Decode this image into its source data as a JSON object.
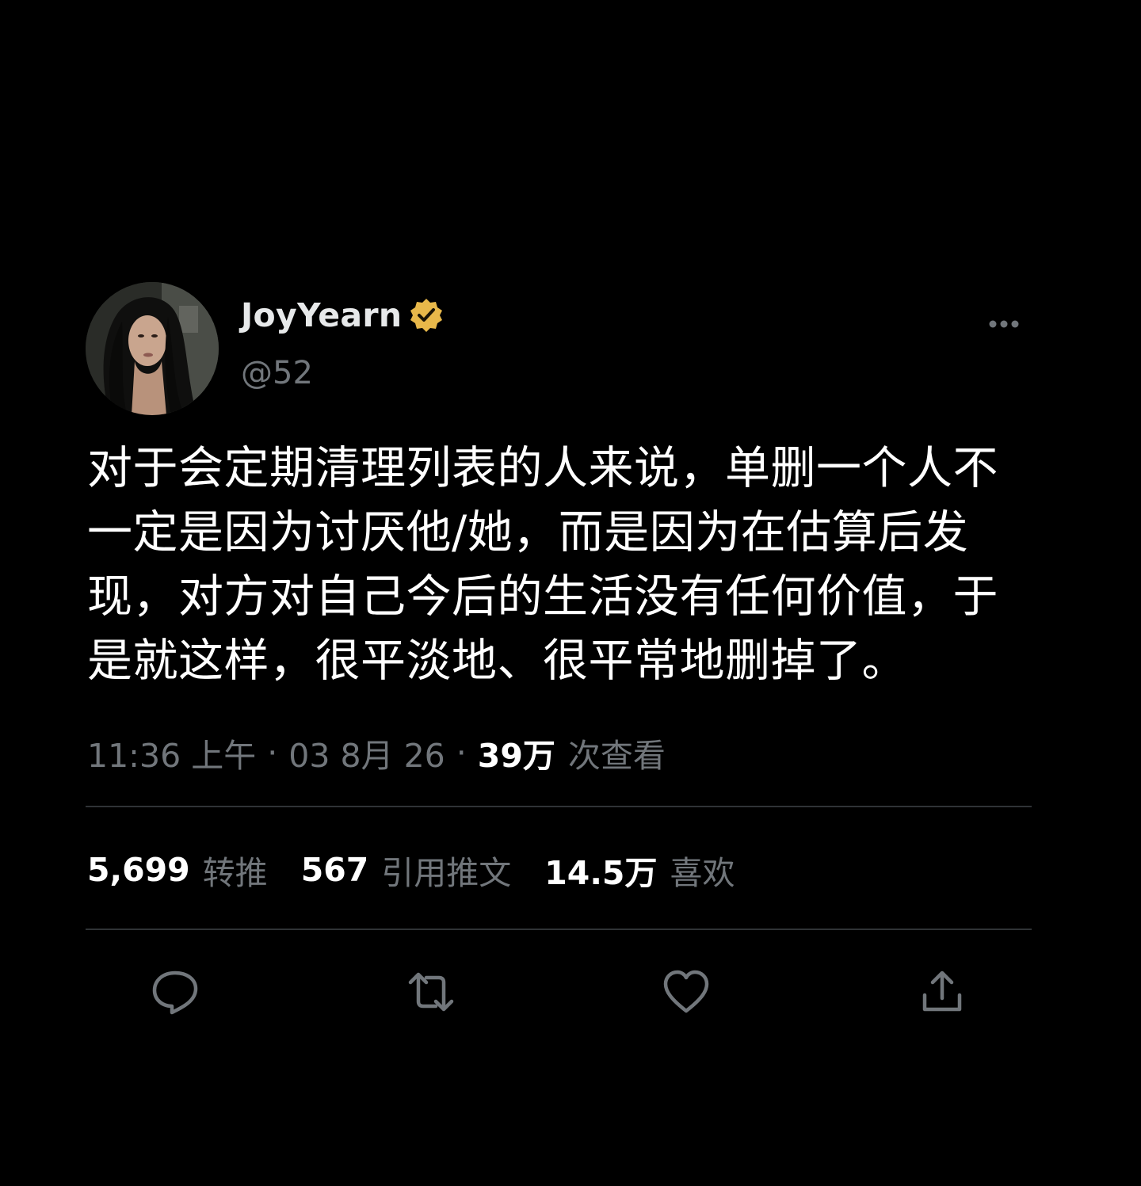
{
  "author": {
    "display_name": "JoyYearn",
    "handle": "@52",
    "verified_badge_color": "#e8b84a"
  },
  "tweet": {
    "text": "对于会定期清理列表的人来说，单删一个人不一定是因为讨厌他/她，而是因为在估算后发现，对方对自己今后的生活没有任何价值，于是就这样，很平淡地、很平常地删掉了。"
  },
  "meta": {
    "time": "11:36 上午",
    "date": "03 8月 26",
    "separator": "·",
    "views_count": "39万",
    "views_label": "次查看"
  },
  "stats": {
    "retweets": {
      "count": "5,699",
      "label": "转推"
    },
    "quotes": {
      "count": "567",
      "label": "引用推文"
    },
    "likes": {
      "count": "14.5万",
      "label": "喜欢"
    }
  },
  "actions": {
    "icons": [
      "reply-icon",
      "retweet-icon",
      "like-icon",
      "share-icon"
    ],
    "icon_color": "#71767b"
  },
  "colors": {
    "background": "#000000",
    "primary_text": "#ffffff",
    "secondary_text": "#71767b",
    "divider": "#2f3336"
  }
}
